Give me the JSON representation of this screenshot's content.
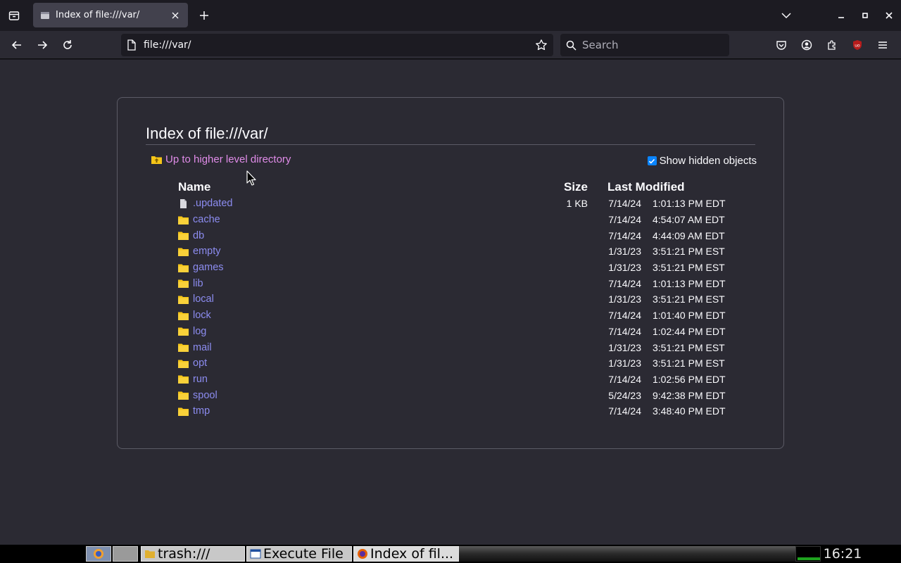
{
  "tab": {
    "title": "Index of file:///var/"
  },
  "navbar": {
    "url": "file:///var/",
    "search_placeholder": "Search"
  },
  "page": {
    "heading": "Index of file:///var/",
    "up_link": "Up to higher level directory",
    "show_hidden_label": "Show hidden objects",
    "show_hidden_checked": true,
    "columns": {
      "name": "Name",
      "size": "Size",
      "modified": "Last Modified"
    },
    "rows": [
      {
        "name": ".updated",
        "kind": "file",
        "size": "1 KB",
        "date": "7/14/24",
        "time": "1:01:13 PM EDT"
      },
      {
        "name": "cache",
        "kind": "folder",
        "size": "",
        "date": "7/14/24",
        "time": "4:54:07 AM EDT"
      },
      {
        "name": "db",
        "kind": "folder",
        "size": "",
        "date": "7/14/24",
        "time": "4:44:09 AM EDT"
      },
      {
        "name": "empty",
        "kind": "folder",
        "size": "",
        "date": "1/31/23",
        "time": "3:51:21 PM EST"
      },
      {
        "name": "games",
        "kind": "folder",
        "size": "",
        "date": "1/31/23",
        "time": "3:51:21 PM EST"
      },
      {
        "name": "lib",
        "kind": "folder",
        "size": "",
        "date": "7/14/24",
        "time": "1:01:13 PM EDT"
      },
      {
        "name": "local",
        "kind": "folder",
        "size": "",
        "date": "1/31/23",
        "time": "3:51:21 PM EST"
      },
      {
        "name": "lock",
        "kind": "folder",
        "size": "",
        "date": "7/14/24",
        "time": "1:01:40 PM EDT"
      },
      {
        "name": "log",
        "kind": "folder",
        "size": "",
        "date": "7/14/24",
        "time": "1:02:44 PM EDT"
      },
      {
        "name": "mail",
        "kind": "folder",
        "size": "",
        "date": "1/31/23",
        "time": "3:51:21 PM EST"
      },
      {
        "name": "opt",
        "kind": "folder",
        "size": "",
        "date": "1/31/23",
        "time": "3:51:21 PM EST"
      },
      {
        "name": "run",
        "kind": "folder",
        "size": "",
        "date": "7/14/24",
        "time": "1:02:56 PM EDT"
      },
      {
        "name": "spool",
        "kind": "folder",
        "size": "",
        "date": "5/24/23",
        "time": "9:42:38 PM EDT"
      },
      {
        "name": "tmp",
        "kind": "folder",
        "size": "",
        "date": "7/14/24",
        "time": "3:48:40 PM EDT"
      }
    ]
  },
  "taskbar": {
    "tasks": [
      {
        "label": "trash:///",
        "icon": "folder-icon"
      },
      {
        "label": "Execute File",
        "icon": "window-icon"
      },
      {
        "label": "Index of fil...",
        "icon": "firefox-icon"
      }
    ],
    "clock": "16:21"
  },
  "colors": {
    "page_bg": "#2b2a33",
    "link": "#8c8cf0",
    "visited_link": "#e08ce8",
    "folder": "#f5c518",
    "accent": "#0a84ff"
  }
}
